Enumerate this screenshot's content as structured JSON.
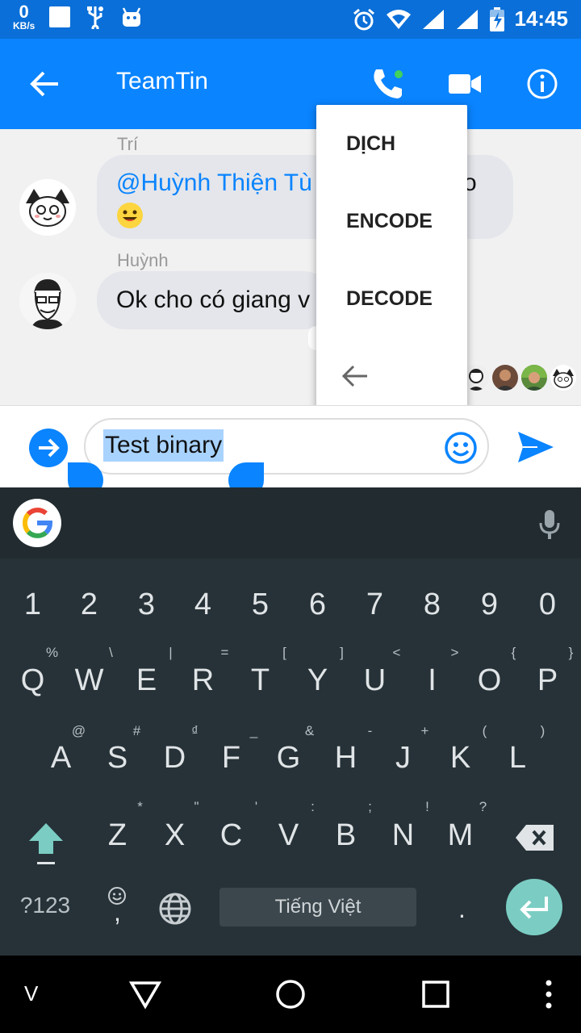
{
  "status_bar": {
    "net_speed_value": "0",
    "net_speed_unit": "KB/s",
    "time": "14:45"
  },
  "header": {
    "title": "TeamTin"
  },
  "messages": [
    {
      "sender": "Trí",
      "mention": "@Huỳnh Thiện Tù",
      "text_tail": "o"
    },
    {
      "sender": "Huỳnh",
      "text": "Ok cho có giang v"
    }
  ],
  "menu": {
    "items": [
      "DỊCH",
      "ENCODE",
      "DECODE"
    ]
  },
  "composer": {
    "value": "Test binary"
  },
  "keyboard": {
    "numbers": [
      "1",
      "2",
      "3",
      "4",
      "5",
      "6",
      "7",
      "8",
      "9",
      "0"
    ],
    "row1": [
      "Q",
      "W",
      "E",
      "R",
      "T",
      "Y",
      "U",
      "I",
      "O",
      "P"
    ],
    "row1_hints": [
      "%",
      "\\",
      "|",
      "=",
      "[",
      "]",
      "<",
      ">",
      "{",
      "}"
    ],
    "row2": [
      "A",
      "S",
      "D",
      "F",
      "G",
      "H",
      "J",
      "K",
      "L"
    ],
    "row2_hints": [
      "@",
      "#",
      "₫",
      "_",
      "&",
      "-",
      "+",
      "(",
      ")"
    ],
    "row3": [
      "Z",
      "X",
      "C",
      "V",
      "B",
      "N",
      "M"
    ],
    "row3_hints": [
      "*",
      "\"",
      "'",
      ":",
      ";",
      "!",
      "?"
    ],
    "symbols_label": "?123",
    "comma": ",",
    "space_label": "Tiếng Việt",
    "period": "."
  },
  "nav": {
    "collapse_label": "V"
  },
  "colors": {
    "accent": "#0a84ff",
    "status_bar": "#0a6fd8",
    "keyboard_bg": "#263238",
    "enter_key": "#7bcdc3"
  }
}
